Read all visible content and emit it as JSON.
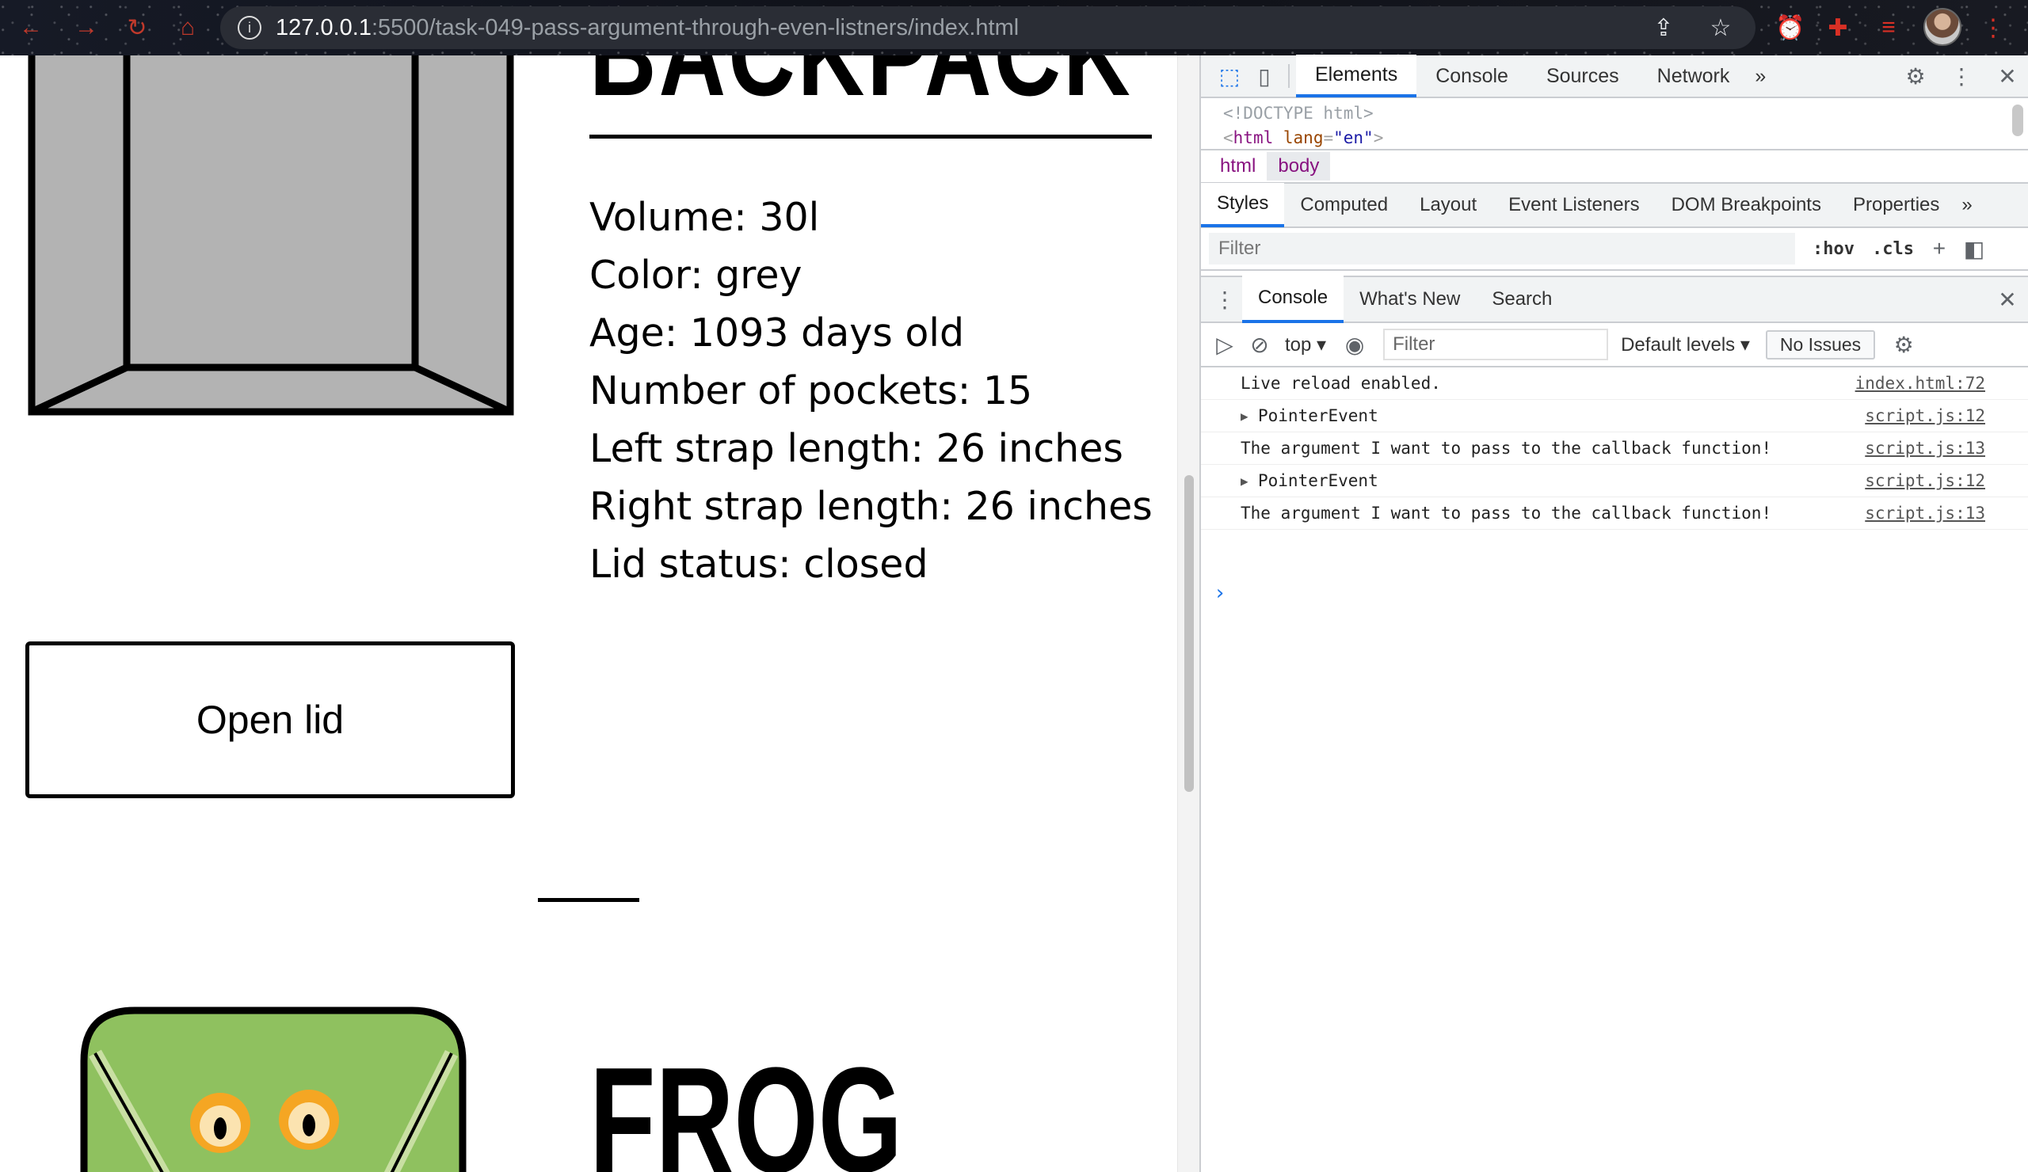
{
  "browser": {
    "url_host": "127.0.0.1",
    "url_path": ":5500/task-049-pass-argument-through-even-listners/index.html"
  },
  "page": {
    "title": "BACKPACK",
    "specs": [
      "Volume: 30l",
      "Color: grey",
      "Age: 1093 days old",
      "Number of pockets: 15",
      "Left strap length: 26 inches",
      "Right strap length: 26 inches",
      "Lid status: closed"
    ],
    "open_lid_button": "Open lid",
    "next_title": "FROG"
  },
  "devtools": {
    "main_tabs": [
      "Elements",
      "Console",
      "Sources",
      "Network"
    ],
    "more": "»",
    "dom_tree": {
      "doctype": "<!DOCTYPE html>",
      "html_tag": "html",
      "lang_attr": "lang",
      "lang_val": "\"en\""
    },
    "breadcrumbs": [
      "html",
      "body"
    ],
    "styles_tabs": [
      "Styles",
      "Computed",
      "Layout",
      "Event Listeners",
      "DOM Breakpoints",
      "Properties"
    ],
    "styles_filter_placeholder": "Filter",
    "hov": ":hov",
    "cls": ".cls",
    "drawer_tabs": [
      "Console",
      "What's New",
      "Search"
    ],
    "context": "top",
    "console_filter_placeholder": "Filter",
    "levels": "Default levels",
    "issues": "No Issues",
    "log": [
      {
        "msg": "Live reload enabled.",
        "src": "index.html:72",
        "expandable": false
      },
      {
        "msg": "PointerEvent",
        "src": "script.js:12",
        "expandable": true
      },
      {
        "msg": "The argument I want to pass to the callback function!",
        "src": "script.js:13",
        "expandable": false
      },
      {
        "msg": "PointerEvent",
        "src": "script.js:12",
        "expandable": true
      },
      {
        "msg": "The argument I want to pass to the callback function!",
        "src": "script.js:13",
        "expandable": false
      }
    ]
  },
  "colors": {
    "accent": "#1a73e8",
    "backpack_fill": "#b3b3b3",
    "frog_green": "#8fc15f",
    "frog_eye": "#f5a623"
  }
}
